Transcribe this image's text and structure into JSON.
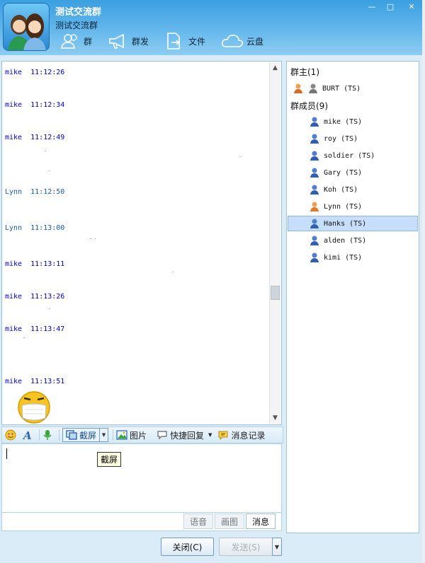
{
  "window": {
    "group_name": "测试交流群",
    "group_subtitle": "测试交流群"
  },
  "toolbar": [
    {
      "icon": "group-icon",
      "label": "群"
    },
    {
      "icon": "megaphone-icon",
      "label": "群发"
    },
    {
      "icon": "file-icon",
      "label": "文件"
    },
    {
      "icon": "cloud-icon",
      "label": "云盘"
    }
  ],
  "messages": [
    {
      "sender": "mike",
      "time": "11:12:26"
    },
    {
      "sender": "mike",
      "time": "11:12:34"
    },
    {
      "sender": "mike",
      "time": "11:12:49"
    },
    {
      "sender": "Lynn",
      "time": "11:12:50"
    },
    {
      "sender": "Lynn",
      "time": "11:13:00"
    },
    {
      "sender": "mike",
      "time": "11:13:11"
    },
    {
      "sender": "mike",
      "time": "11:13:26"
    },
    {
      "sender": "mike",
      "time": "11:13:47"
    },
    {
      "sender": "mike",
      "time": "11:13:51"
    }
  ],
  "input_toolbar": {
    "screenshot": "截屏",
    "image": "图片",
    "quick_reply": "快捷回复",
    "history": "消息记录"
  },
  "tooltip": "截屏",
  "tabs": [
    "语音",
    "画图",
    "消息"
  ],
  "buttons": {
    "close": "关闭(C)",
    "send": "发送(S)"
  },
  "members": {
    "owner_header": "群主(1)",
    "owner": "BURT (TS)",
    "members_header": "群成员(9)",
    "list": [
      "mike (TS)",
      "roy (TS)",
      "soldier (TS)",
      "Gary (TS)",
      "Koh (TS)",
      "Lynn (TS)",
      "Hanks (TS)",
      "alden (TS)",
      "kimi (TS)"
    ],
    "selected": "Hanks (TS)"
  }
}
